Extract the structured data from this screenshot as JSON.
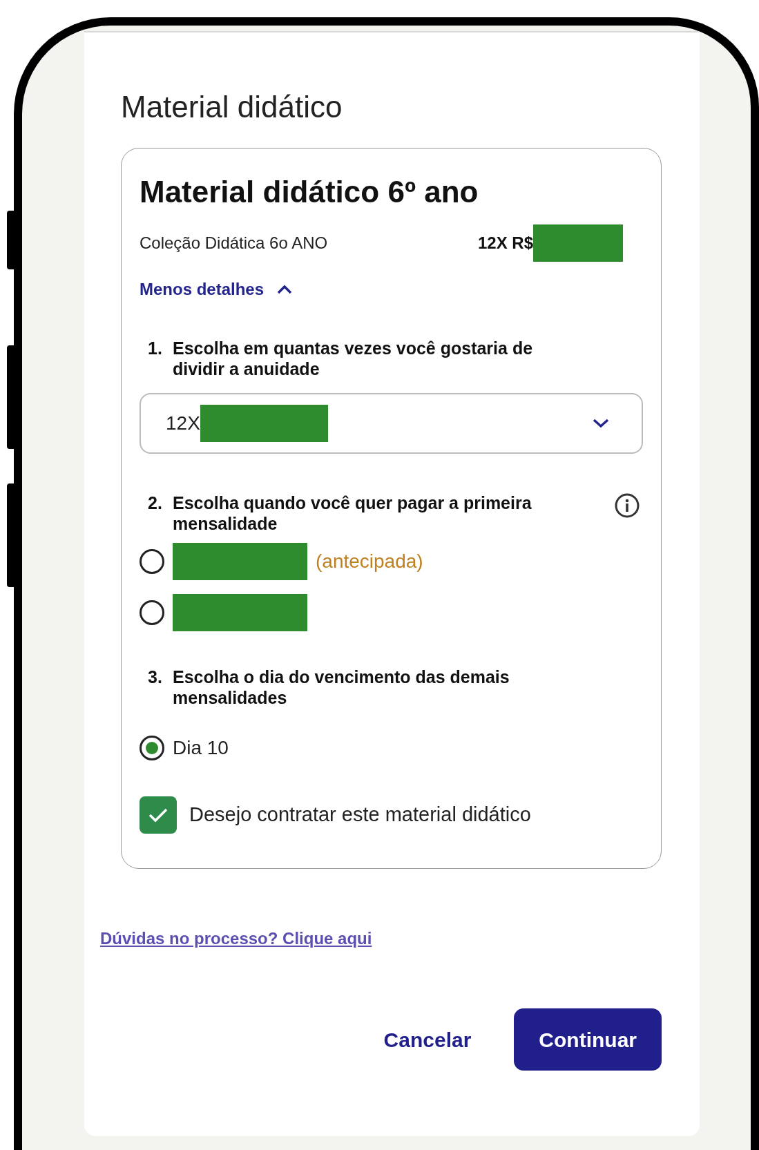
{
  "page_title": "Material didático",
  "card": {
    "title": "Material didático 6º ano",
    "product": {
      "name": "Coleção Didática 6o ANO",
      "price": "12X R$"
    },
    "details_toggle": {
      "label": "Menos detalhes",
      "expanded": true
    },
    "steps": [
      {
        "number": "1.",
        "text": "Escolha em quantas vezes você gostaria de dividir a anuidade",
        "kind": "select",
        "value": "12X"
      },
      {
        "number": "2.",
        "text": "Escolha quando você quer pagar a primeira mensalidade",
        "kind": "radio",
        "info": true,
        "options": [
          {
            "note": "(antecipada)",
            "selected": false
          },
          {
            "selected": false
          }
        ]
      },
      {
        "number": "3.",
        "text": "Escolha o dia do vencimento das demais mensalidades",
        "kind": "radio",
        "options": [
          {
            "label": "Dia 10",
            "selected": true
          }
        ]
      }
    ],
    "confirm": {
      "label": "Desejo contratar este material didático",
      "checked": true
    }
  },
  "help_link": "Dúvidas no processo? Clique aqui",
  "buttons": [
    {
      "label": "Cancelar",
      "kind": "text"
    },
    {
      "label": "Continuar",
      "kind": "primary"
    }
  ]
}
